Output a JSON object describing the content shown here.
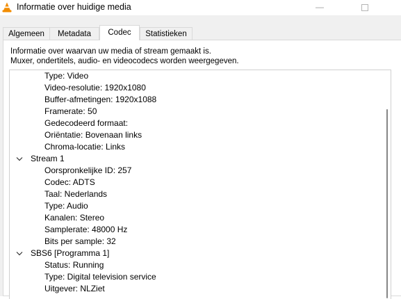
{
  "window": {
    "title": "Informatie over huidige media",
    "app_icon": "vlc-cone-icon"
  },
  "tabs": [
    {
      "label": "Algemeen",
      "active": false
    },
    {
      "label": "Metadata",
      "active": false
    },
    {
      "label": "Codec",
      "active": true
    },
    {
      "label": "Statistieken",
      "active": false
    }
  ],
  "codec": {
    "description_line1": "Informatie over waarvan uw media of stream gemaakt is.",
    "description_line2": "Muxer, ondertitels, audio- en videocodecs worden weergegeven.",
    "tree": [
      {
        "text": "Type: Video",
        "level": 1
      },
      {
        "text": "Video-resolutie: 1920x1080",
        "level": 1
      },
      {
        "text": "Buffer-afmetingen: 1920x1088",
        "level": 1
      },
      {
        "text": "Framerate: 50",
        "level": 1
      },
      {
        "text": "Gedecodeerd formaat:",
        "level": 1
      },
      {
        "text": "Oriëntatie: Bovenaan links",
        "level": 1
      },
      {
        "text": "Chroma-locatie: Links",
        "level": 1
      },
      {
        "text": "Stream 1",
        "level": 0,
        "expanded": true
      },
      {
        "text": "Oorspronkelijke ID: 257",
        "level": 1
      },
      {
        "text": "Codec: ADTS",
        "level": 1
      },
      {
        "text": "Taal: Nederlands",
        "level": 1
      },
      {
        "text": "Type: Audio",
        "level": 1
      },
      {
        "text": "Kanalen: Stereo",
        "level": 1
      },
      {
        "text": "Samplerate: 48000 Hz",
        "level": 1
      },
      {
        "text": "Bits per sample: 32",
        "level": 1
      },
      {
        "text": "SBS6 [Programma 1]",
        "level": 0,
        "expanded": true
      },
      {
        "text": "Status: Running",
        "level": 1
      },
      {
        "text": "Type: Digital television service",
        "level": 1
      },
      {
        "text": "Uitgever: NLZiet",
        "level": 1
      }
    ]
  }
}
